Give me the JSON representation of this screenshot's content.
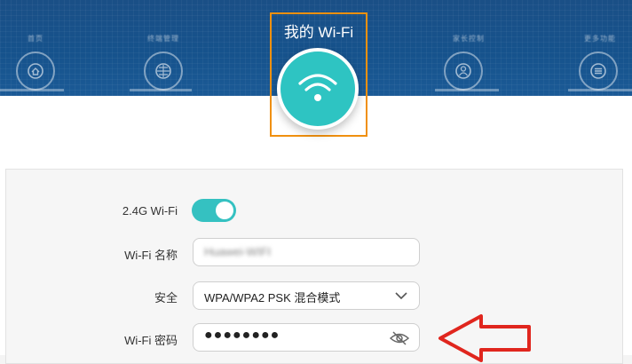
{
  "header": {
    "nav_left": [
      {
        "label": "首页",
        "icon": "home-icon"
      },
      {
        "label": "终端管理",
        "icon": "devices-icon"
      }
    ],
    "active": {
      "label": "我的 Wi-Fi",
      "icon": "wifi-icon"
    },
    "nav_right": [
      {
        "label": "家长控制",
        "icon": "parental-icon"
      },
      {
        "label": "更多功能",
        "icon": "menu-icon"
      }
    ]
  },
  "settings": {
    "wifi_24g": {
      "label": "2.4G Wi-Fi",
      "enabled": true
    },
    "wifi_name": {
      "label": "Wi-Fi 名称",
      "value": "Huawei-WIFI"
    },
    "security": {
      "label": "安全",
      "value": "WPA/WPA2 PSK 混合模式"
    },
    "password": {
      "label": "Wi-Fi 密码",
      "value": "●●●●●●●●"
    }
  },
  "colors": {
    "accent": "#2ec4c2",
    "highlight": "#f0900f",
    "arrow": "#e0261e",
    "banner": "#16528c"
  }
}
